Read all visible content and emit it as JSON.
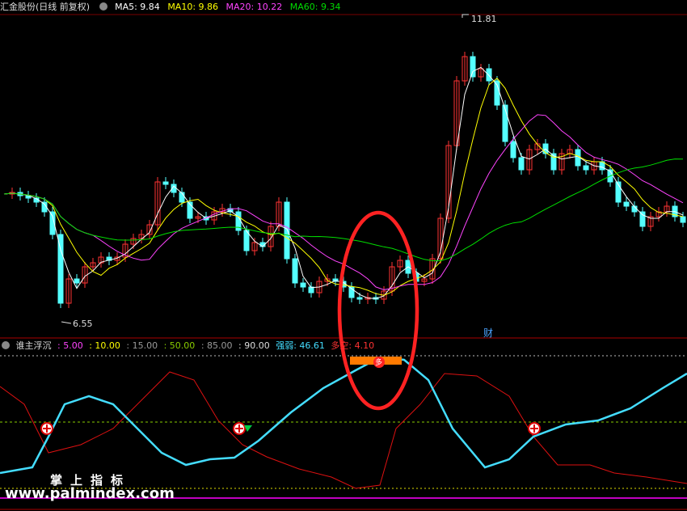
{
  "header": {
    "stock_title": "汇金股份(日线 前复权)",
    "ma5": "MA5: 9.84",
    "ma10": "MA10: 9.86",
    "ma20": "MA20: 10.22",
    "ma60": "MA60: 9.34"
  },
  "annotations": {
    "high_label": "11.81",
    "low_label": "6.55",
    "cai_label": "财",
    "duo_badge": "多"
  },
  "indicator": {
    "name": "谁主浮沉",
    "levels": [
      ": 5.00",
      ": 10.00",
      ": 15.00",
      ": 50.00",
      ": 85.00",
      ": 90.00"
    ],
    "strength": "强弱: 46.61",
    "longshort": "多空: 4.10"
  },
  "watermark": {
    "title": "掌上指标",
    "url": "www.palmindex.com"
  },
  "colors": {
    "up": "#ff3333",
    "down": "#54ffff",
    "ma5": "#ffffff",
    "ma10": "#ffff00",
    "ma20": "#ff44ff",
    "ma60": "#00dd00",
    "strength_line": "#44ddff",
    "longshort_line": "#dd1111",
    "highlight_circle": "#ff2222"
  }
}
